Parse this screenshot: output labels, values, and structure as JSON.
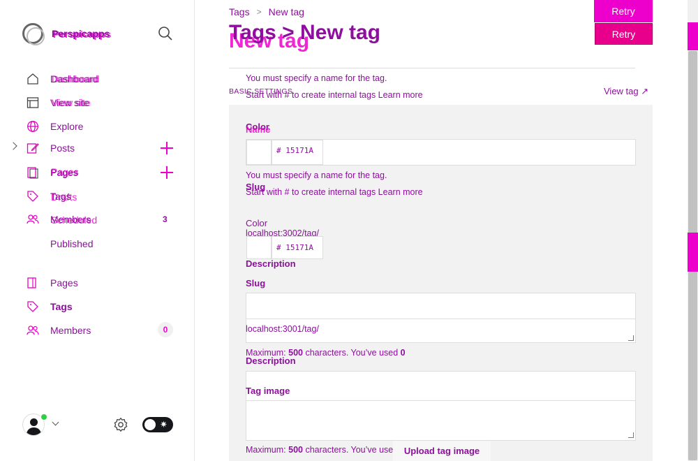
{
  "brand": {
    "name": "Perspicapps",
    "name_ghost": "Perspicapps"
  },
  "sidebar": {
    "items_ghost": [
      {
        "label": "Dashboard"
      },
      {
        "label": "View site"
      },
      {
        "label": "Pages"
      },
      {
        "label": "Drafts"
      },
      {
        "label": "Scheduled"
      }
    ],
    "items": [
      {
        "label": "Dashboard",
        "icon": "home-icon"
      },
      {
        "label": "View site",
        "icon": "browser-icon"
      },
      {
        "label": "Explore",
        "icon": "globe-icon"
      },
      {
        "label": "Posts",
        "icon": "edit-icon"
      },
      {
        "label": "Pages",
        "icon": "page-icon"
      },
      {
        "label": "Tags",
        "icon": "tag-icon"
      },
      {
        "label": "Members",
        "icon": "members-icon"
      },
      {
        "label": "Published"
      },
      {
        "label": "Pages",
        "icon": "page-icon"
      },
      {
        "label": "Tags",
        "icon": "tag-icon"
      },
      {
        "label": "Members",
        "icon": "members-icon"
      }
    ],
    "members_count_top": "3",
    "members_count_bottom": "0"
  },
  "breadcrumb": {
    "parent": "Tags",
    "separator": ">",
    "current": "New tag"
  },
  "title": "Tags > New tag",
  "title_ghost": "New tag",
  "buttons": {
    "retry_top": "Retry",
    "retry": "Retry",
    "upload": "Upload tag image"
  },
  "errors": {
    "name_required_1": "You must specify a name for the tag.",
    "name_hint_1": "Start with # to create internal tags Learn more",
    "name_required_2": "You must specify a name for the tag.",
    "name_hint_2": "Start with # to create internal tags Learn more"
  },
  "section": {
    "basic_settings": "BASIC SETTINGS",
    "view_tag": "View tag ↗"
  },
  "form": {
    "color_label_1": "Color",
    "name_label": "Name",
    "hex_1": "# 15171A",
    "slug_label_1": "Slug",
    "color_label_2": "Color",
    "url_1": "localhost:3002/tag/",
    "hex_2": "# 15171A",
    "description_label_1": "Description",
    "slug_label_2": "Slug",
    "url_2": "localhost:3001/tag/",
    "max_text_1": "Maximum: ",
    "max_value_1": "500",
    "max_rest_1": " characters. You’ve used ",
    "used_1": "0",
    "description_label_2": "Description",
    "tag_image_label": "Tag image",
    "max_text_2": "Maximum: ",
    "max_value_2": "500",
    "max_rest_2": " characters. You’ve used 0"
  },
  "colors": {
    "accent": "#ee00cc",
    "text_purple": "#8e0e9e",
    "retry_bg": "#e8008d"
  }
}
